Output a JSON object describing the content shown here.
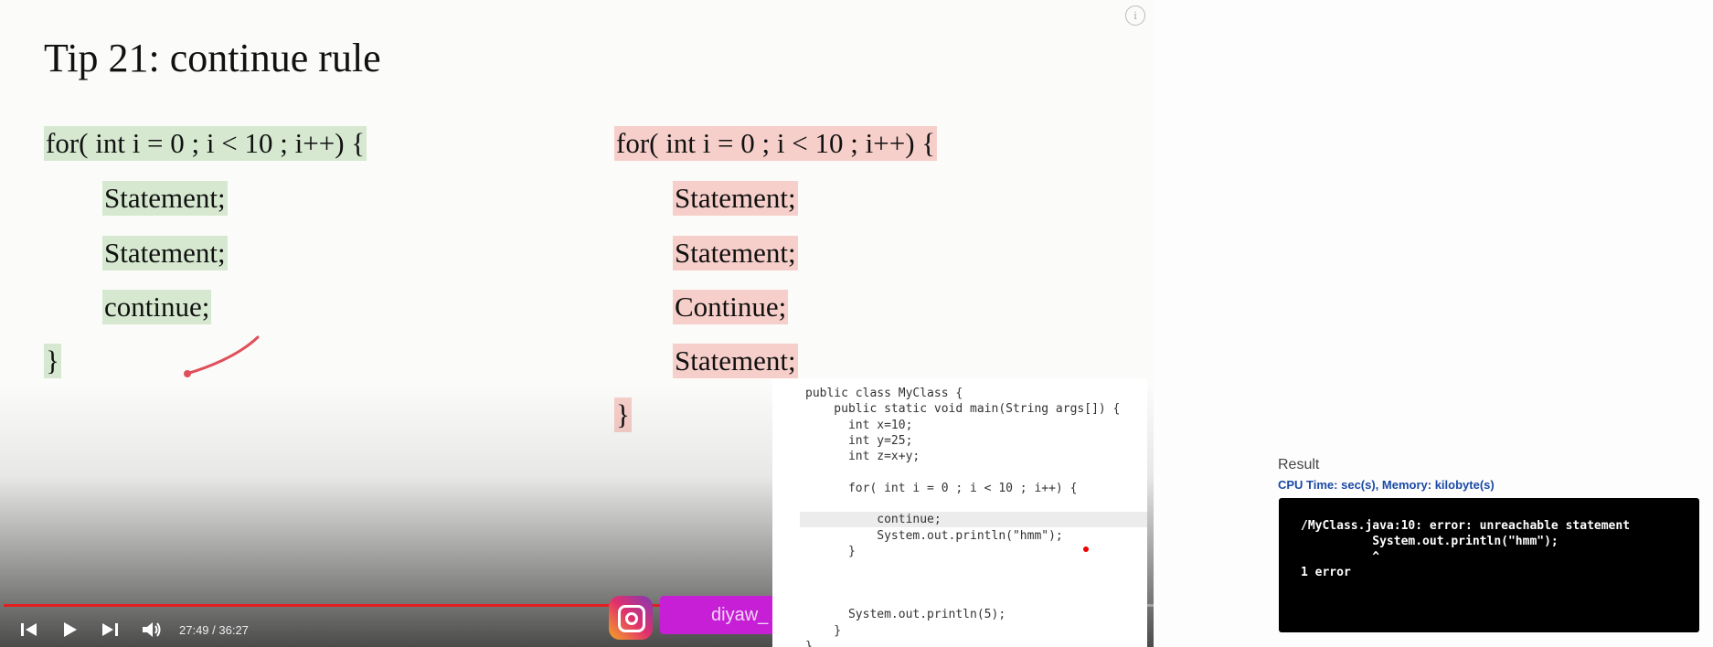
{
  "video": {
    "title": "Tip 21: continue rule",
    "info_glyph": "i",
    "left_code": {
      "line1": "for( int i = 0 ; i < 10 ; i++) {",
      "line2": "Statement;",
      "line3": "Statement;",
      "line4": "continue;",
      "line5": "}"
    },
    "right_code": {
      "line1": "for( int i = 0 ; i < 10 ; i++) {",
      "line2": "Statement;",
      "line3": "Statement;",
      "line4": "Continue;",
      "line5": "Statement;",
      "line6": "}"
    },
    "player": {
      "time": "27:49 / 36:27",
      "progress_fraction": 0.7631,
      "progress_color": "#e41e1e"
    },
    "overlay": {
      "handle": "diyaw_",
      "brand_color": "#c61fd6"
    }
  },
  "editor": {
    "lines": [
      "public class MyClass {",
      "    public static void main(String args[]) {",
      "      int x=10;",
      "      int y=25;",
      "      int z=x+y;",
      "",
      "      for( int i = 0 ; i < 10 ; i++) {",
      "",
      "          continue;",
      "          System.out.println(\"hmm\");",
      "      }",
      "",
      "",
      "",
      "      System.out.println(5);",
      "    }",
      "}"
    ]
  },
  "result": {
    "label": "Result",
    "cpu": "CPU Time: sec(s), Memory: kilobyte(s)",
    "output": "/MyClass.java:10: error: unreachable statement\n          System.out.println(\"hmm\");\n          ^\n1 error"
  }
}
